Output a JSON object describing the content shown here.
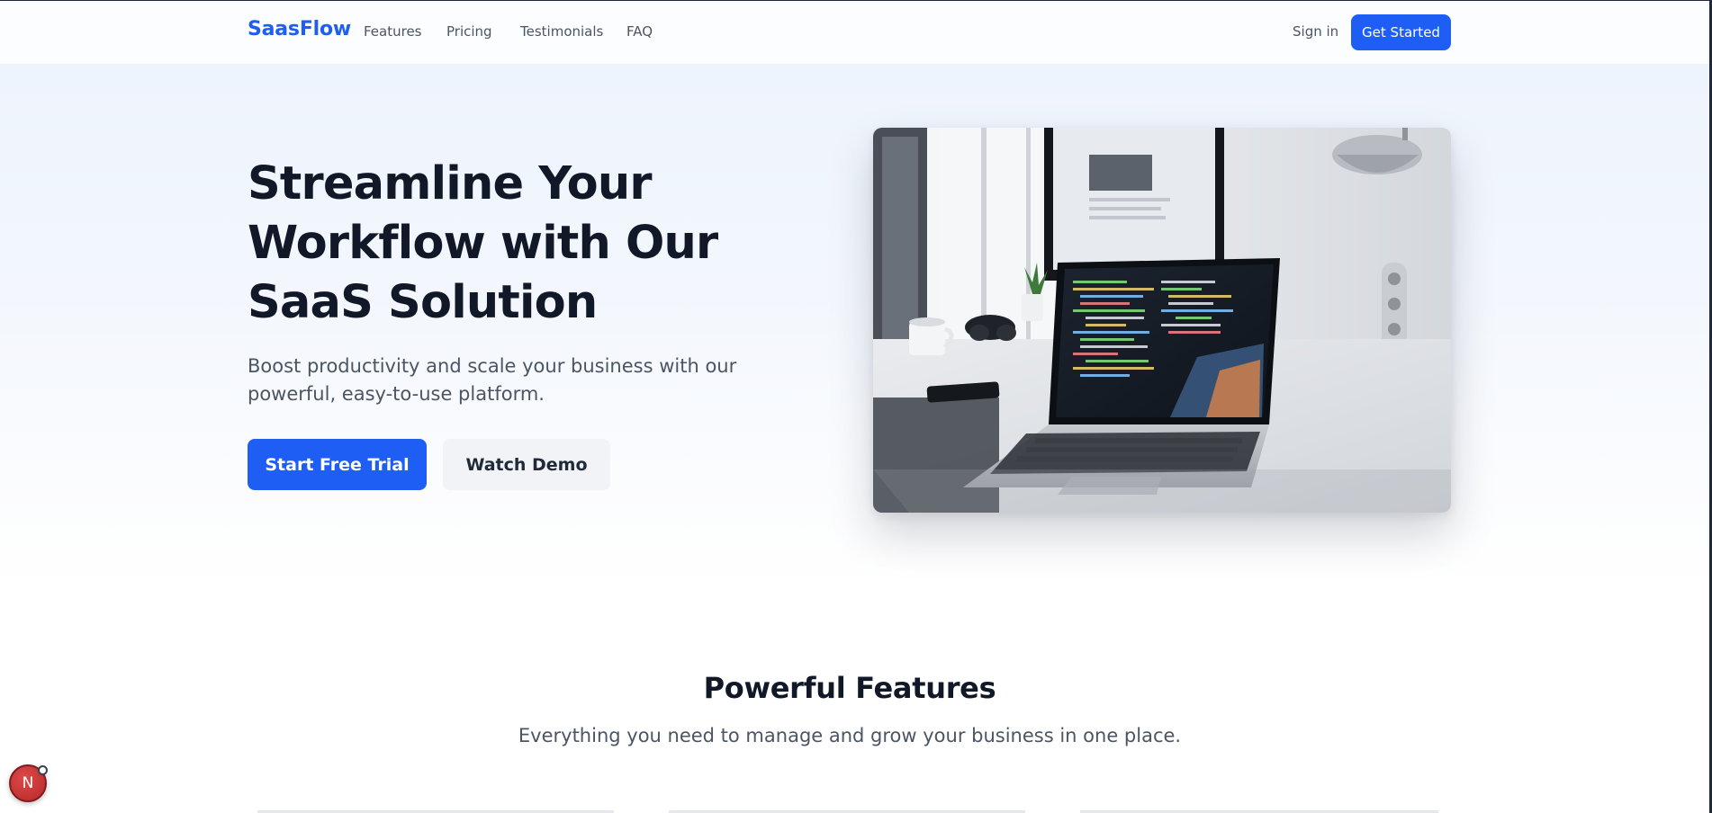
{
  "nav": {
    "brand": "SaasFlow",
    "links": [
      "Features",
      "Pricing",
      "Testimonials",
      "FAQ"
    ],
    "sign_in": "Sign in",
    "get_started": "Get Started"
  },
  "hero": {
    "title": "Streamline Your Workflow with Our SaaS Solution",
    "subtitle": "Boost productivity and scale your business with our powerful, easy-to-use platform.",
    "primary_cta": "Start Free Trial",
    "secondary_cta": "Watch Demo",
    "image_alt": "Laptop with code on a desk"
  },
  "features": {
    "title": "Powerful Features",
    "subtitle": "Everything you need to manage and grow your business in one place."
  },
  "floating_badge": {
    "letter": "N"
  },
  "colors": {
    "accent": "#1f5ef5",
    "text_dark": "#111827",
    "text_muted": "#4b5563",
    "hero_bg": "#eef4fd"
  }
}
